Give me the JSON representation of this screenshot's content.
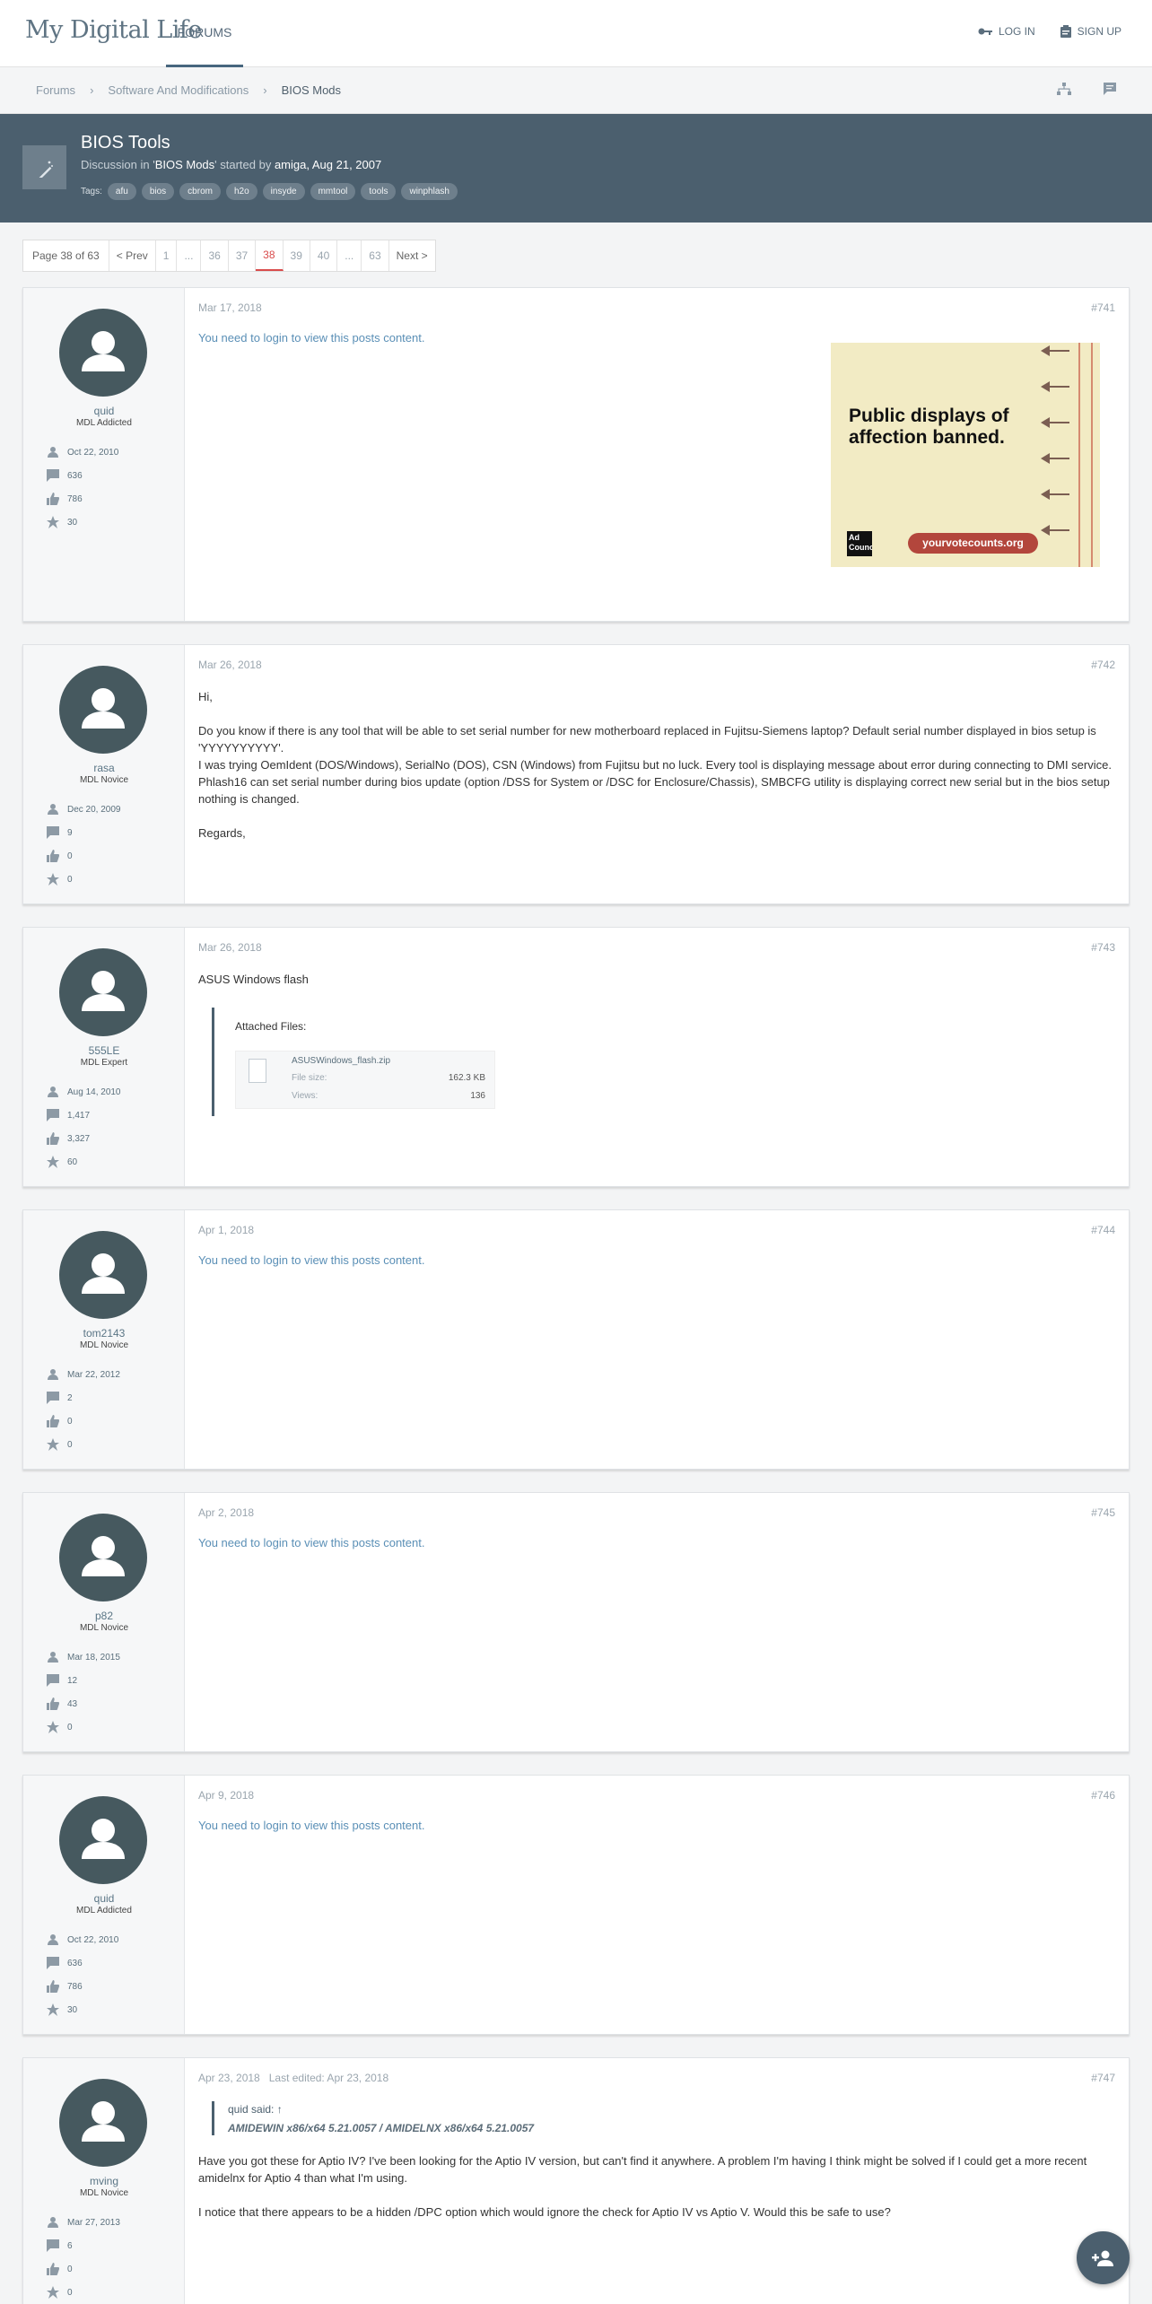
{
  "header": {
    "logo_text": "My Digital Life",
    "nav_forums": "FORUMS",
    "login": "LOG IN",
    "signup": "SIGN UP"
  },
  "breadcrumb": [
    "Forums",
    "Software And Modifications",
    "BIOS Mods"
  ],
  "thread": {
    "title": "BIOS Tools",
    "discussion_in_prefix": "Discussion in '",
    "forum": "BIOS Mods",
    "started_by_text": "' started by ",
    "author": "amiga",
    "date": ", Aug 21, 2007",
    "tags_label": "Tags:",
    "tags": [
      "afu",
      "bios",
      "cbrom",
      "h2o",
      "insyde",
      "mmtool",
      "tools",
      "winphlash"
    ]
  },
  "pagination": {
    "label": "Page 38 of 63",
    "prev": "< Prev",
    "pages": [
      "1",
      "...",
      "36",
      "37",
      "38",
      "39",
      "40",
      "...",
      "63"
    ],
    "next": "Next >",
    "current": "38"
  },
  "login_message": "You need to login to view this posts content.",
  "posts": [
    {
      "username": "quid",
      "usertitle": "MDL Addicted",
      "joined": "Oct 22, 2010",
      "messages": "636",
      "likes": "786",
      "points": "30",
      "date": "Mar 17, 2018",
      "num": "#741",
      "ad": {
        "headline": "Public displays of affection banned.",
        "logo": "Ad Council",
        "button": "yourvotecounts.org"
      }
    },
    {
      "username": "rasa",
      "usertitle": "MDL Novice",
      "joined": "Dec 20, 2009",
      "messages": "9",
      "likes": "0",
      "points": "0",
      "date": "Mar 26, 2018",
      "num": "#742",
      "body": [
        "Hi,",
        "Do you know if there is any tool that will be able to set serial number for new motherboard replaced in Fujitsu-Siemens laptop? Default serial number displayed in bios setup is 'YYYYYYYYYY'.\nI was trying OemIdent (DOS/Windows), SerialNo (DOS), CSN (Windows) from Fujitsu but no luck. Every tool is displaying message about error during connecting to DMI service.\nPhlash16 can set serial number during bios update (option /DSS for System or /DSC for Enclosure/Chassis), SMBCFG utility is displaying correct new serial but in the bios setup nothing is changed.",
        "Regards,"
      ]
    },
    {
      "username": "555LE",
      "usertitle": "MDL Expert",
      "joined": "Aug 14, 2010",
      "messages": "1,417",
      "likes": "3,327",
      "points": "60",
      "date": "Mar 26, 2018",
      "num": "#743",
      "body_text": "ASUS Windows flash",
      "attachments": {
        "title": "Attached Files:",
        "file_name": "ASUSWindows_flash.zip",
        "size_label": "File size:",
        "size": "162.3 KB",
        "views_label": "Views:",
        "views": "136"
      }
    },
    {
      "username": "tom2143",
      "usertitle": "MDL Novice",
      "joined": "Mar 22, 2012",
      "messages": "2",
      "likes": "0",
      "points": "0",
      "date": "Apr 1, 2018",
      "num": "#744"
    },
    {
      "username": "p82",
      "usertitle": "MDL Novice",
      "joined": "Mar 18, 2015",
      "messages": "12",
      "likes": "43",
      "points": "0",
      "date": "Apr 2, 2018",
      "num": "#745"
    },
    {
      "username": "quid",
      "usertitle": "MDL Addicted",
      "joined": "Oct 22, 2010",
      "messages": "636",
      "likes": "786",
      "points": "30",
      "date": "Apr 9, 2018",
      "num": "#746"
    },
    {
      "username": "mving",
      "usertitle": "MDL Novice",
      "joined": "Mar 27, 2013",
      "messages": "6",
      "likes": "0",
      "points": "0",
      "date": "Apr 23, 2018",
      "edited": "Last edited: Apr 23, 2018",
      "num": "#747",
      "quote": {
        "who": "quid said: ↑",
        "text": "AMIDEWIN x86/x64 5.21.0057 / AMIDELNX x86/x64 5.21.0057"
      },
      "body": [
        "Have you got these for Aptio IV? I've been looking for the Aptio IV version, but can't find it anywhere. A problem I'm having I think might be solved if I could get a more recent amidelnx for Aptio 4 than what I'm using.",
        "I notice that there appears to be a hidden /DPC option which would ignore the check for Aptio IV vs Aptio V. Would this be safe to use?"
      ]
    }
  ],
  "icons": {
    "login": "key-icon",
    "signup": "clipboard-icon",
    "sitemap": "sitemap-icon",
    "chat": "chat-icon",
    "joined": "user-icon",
    "messages": "message-icon",
    "likes": "thumbs-up-icon",
    "points": "star-icon",
    "fab": "add-user-icon"
  },
  "colors": {
    "header_bg": "#4b5f6e",
    "link": "#5a8fb6",
    "current_page": "#d94b4b"
  }
}
